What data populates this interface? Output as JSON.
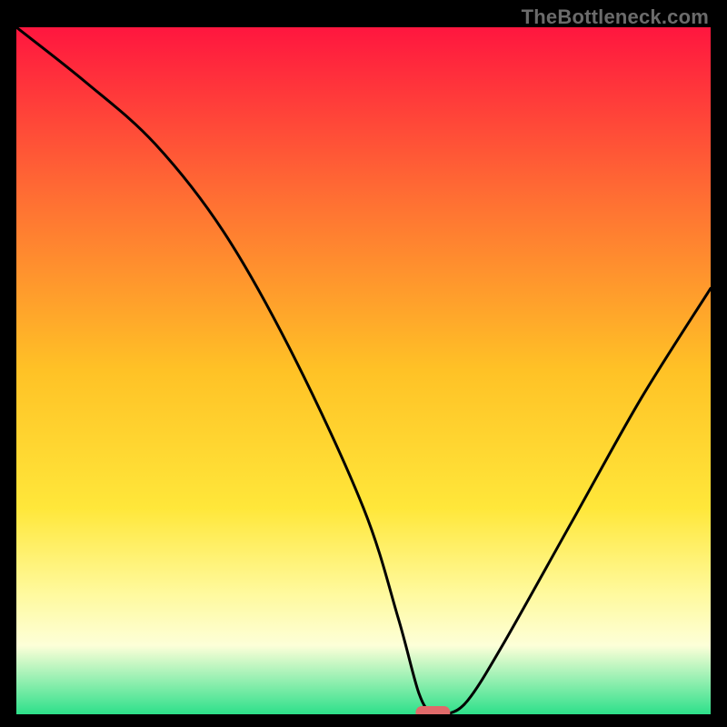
{
  "watermark": "TheBottleneck.com",
  "chart_data": {
    "type": "line",
    "title": "",
    "xlabel": "",
    "ylabel": "",
    "ylim": [
      0,
      100
    ],
    "xlim": [
      0,
      100
    ],
    "x": [
      0,
      10,
      20,
      30,
      40,
      50,
      55,
      58,
      60,
      62,
      65,
      70,
      80,
      90,
      100
    ],
    "values": [
      100,
      92,
      83,
      70,
      52,
      30,
      14,
      3,
      0,
      0,
      2,
      10,
      28,
      46,
      62
    ],
    "annotations": {
      "optimal_marker": {
        "x": 60,
        "y": 0,
        "color": "#e06a6a"
      }
    },
    "gradient_stops": [
      {
        "offset": 0.0,
        "color": "#ff163f"
      },
      {
        "offset": 0.25,
        "color": "#ff6f33"
      },
      {
        "offset": 0.5,
        "color": "#ffc226"
      },
      {
        "offset": 0.7,
        "color": "#ffe73a"
      },
      {
        "offset": 0.82,
        "color": "#fff99a"
      },
      {
        "offset": 0.9,
        "color": "#fdffd8"
      },
      {
        "offset": 1.0,
        "color": "#2de08a"
      }
    ]
  }
}
